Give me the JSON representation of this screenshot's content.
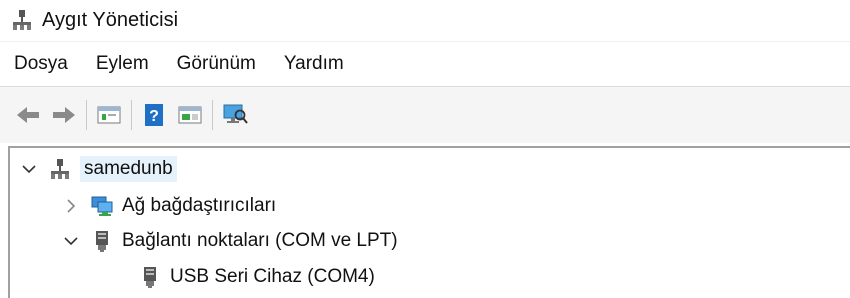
{
  "window": {
    "title": "Aygıt Yöneticisi",
    "icon": "device-manager-icon"
  },
  "menu": [
    "Dosya",
    "Eylem",
    "Görünüm",
    "Yardım"
  ],
  "toolbar": {
    "buttons": [
      "back-icon",
      "forward-icon",
      "properties-view-icon",
      "help-icon",
      "update-driver-icon",
      "scan-hardware-icon"
    ]
  },
  "tree": {
    "root": {
      "label": "samedunb",
      "expanded": true,
      "icon": "computer-network-icon"
    },
    "children": [
      {
        "label": "Ağ bağdaştırıcıları",
        "expanded": false,
        "icon": "network-adapter-icon"
      },
      {
        "label": "Bağlantı noktaları (COM ve LPT)",
        "expanded": true,
        "icon": "port-icon",
        "children": [
          {
            "label": "USB Seri Cihaz (COM4)",
            "icon": "usb-serial-icon"
          }
        ]
      }
    ]
  },
  "colors": {
    "selection": "#e5f1fb",
    "toolbar_bg": "#f5f5f5",
    "accent_blue": "#1f6fc5"
  }
}
